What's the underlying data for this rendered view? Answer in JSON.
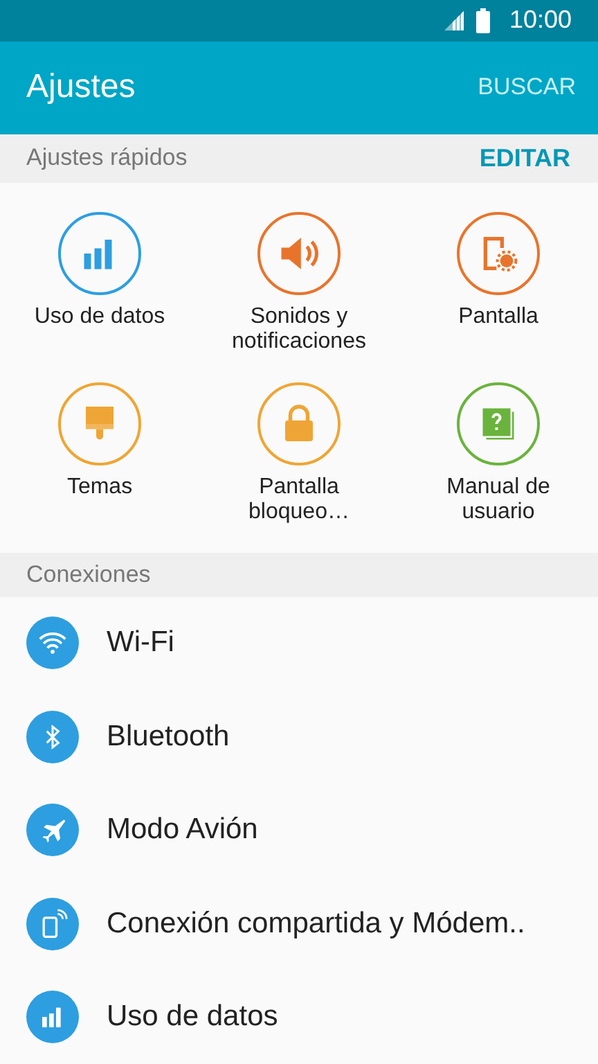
{
  "status_bar": {
    "time": "10:00"
  },
  "app_bar": {
    "title": "Ajustes",
    "action": "BUSCAR"
  },
  "quick_settings": {
    "header": "Ajustes rápidos",
    "action": "EDITAR",
    "items": [
      {
        "label": "Uso de datos",
        "kind": "data",
        "color": "#2d9ee0"
      },
      {
        "label": "Sonidos y notificaciones",
        "kind": "sound",
        "color": "#e8742c"
      },
      {
        "label": "Pantalla",
        "kind": "display",
        "color": "#e8742c"
      },
      {
        "label": "Temas",
        "kind": "themes",
        "color": "#efa535"
      },
      {
        "label": "Pantalla bloqueo…",
        "kind": "lock",
        "color": "#efa535"
      },
      {
        "label": "Manual de usuario",
        "kind": "manual",
        "color": "#6ab33c"
      }
    ]
  },
  "connections": {
    "header": "Conexiones",
    "items": [
      {
        "label": "Wi-Fi",
        "kind": "wifi"
      },
      {
        "label": "Bluetooth",
        "kind": "bluetooth"
      },
      {
        "label": "Modo Avión",
        "kind": "airplane"
      },
      {
        "label": "Conexión compartida y Módem..",
        "kind": "tethering"
      },
      {
        "label": "Uso de datos",
        "kind": "data"
      }
    ]
  }
}
